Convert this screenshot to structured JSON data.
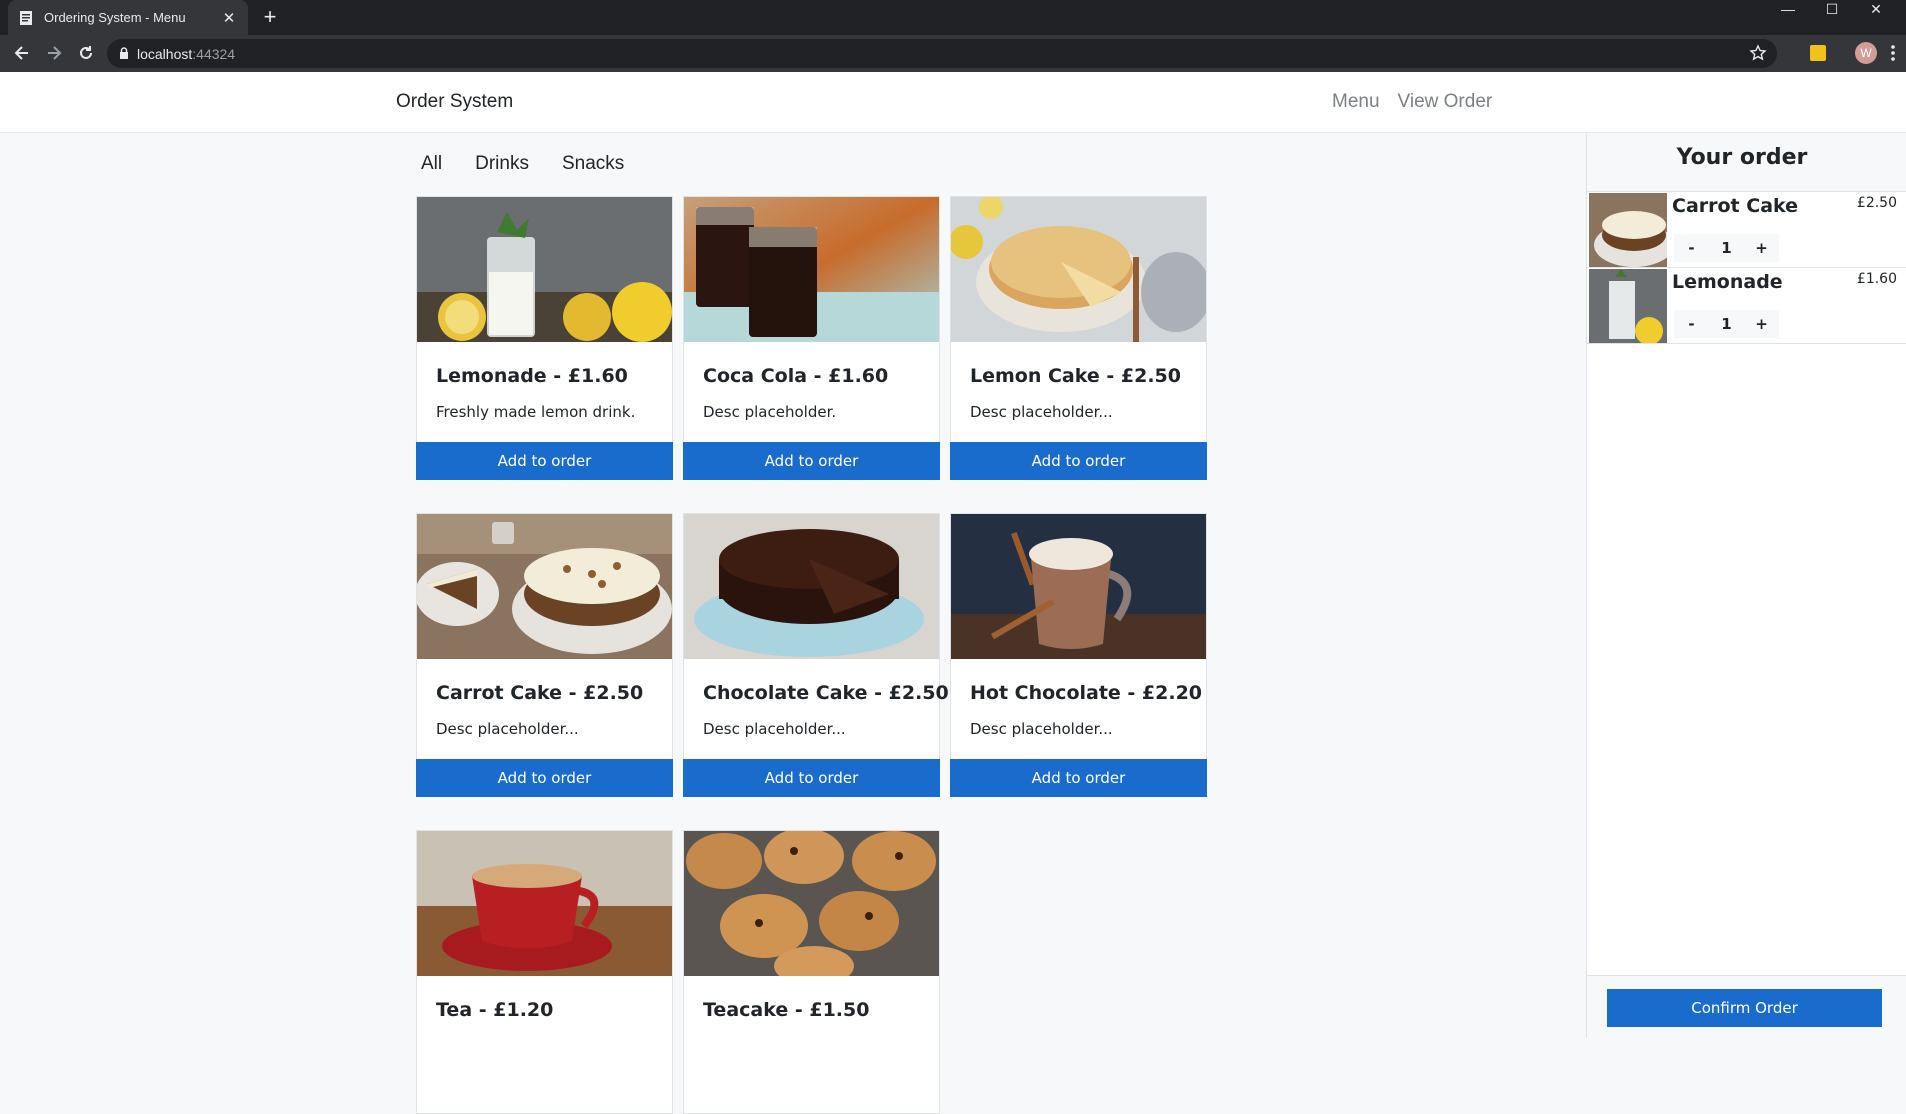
{
  "browser": {
    "tab_title": "Ordering System - Menu",
    "tab_close": "✕",
    "new_tab": "+",
    "url_host": "localhost",
    "url_port": ":44324",
    "avatar_letter": "W",
    "window_controls": {
      "minimize": "—",
      "maximize": "☐",
      "close": "✕"
    }
  },
  "app": {
    "brand": "Order System",
    "nav": {
      "menu": "Menu",
      "view_order": "View Order"
    },
    "categories": [
      "All",
      "Drinks",
      "Snacks"
    ],
    "add_label": "Add to order",
    "accent_color": "#1a6ccc",
    "items": [
      {
        "name": "Lemonade - £1.60",
        "desc": "Freshly made lemon drink.",
        "image": "lemonade-photo"
      },
      {
        "name": "Coca Cola - £1.60",
        "desc": "Desc placeholder.",
        "image": "cola-photo"
      },
      {
        "name": "Lemon Cake - £2.50",
        "desc": "Desc placeholder...",
        "image": "lemon-cake-photo"
      },
      {
        "name": "Carrot Cake - £2.50",
        "desc": "Desc placeholder...",
        "image": "carrot-cake-photo"
      },
      {
        "name": "Chocolate Cake - £2.50",
        "desc": "Desc placeholder...",
        "image": "chocolate-cake-photo"
      },
      {
        "name": "Hot Chocolate - £2.20",
        "desc": "Desc placeholder...",
        "image": "hot-chocolate-photo"
      },
      {
        "name": "Tea - £1.20",
        "desc": "",
        "image": "tea-photo"
      },
      {
        "name": "Teacake - £1.50",
        "desc": "",
        "image": "teacake-photo"
      }
    ]
  },
  "order": {
    "title": "Your order",
    "items": [
      {
        "name": "Carrot Cake",
        "price": "£2.50",
        "qty": "1",
        "minus": "-",
        "plus": "+"
      },
      {
        "name": "Lemonade",
        "price": "£1.60",
        "qty": "1",
        "minus": "-",
        "plus": "+"
      }
    ],
    "confirm_label": "Confirm Order"
  }
}
